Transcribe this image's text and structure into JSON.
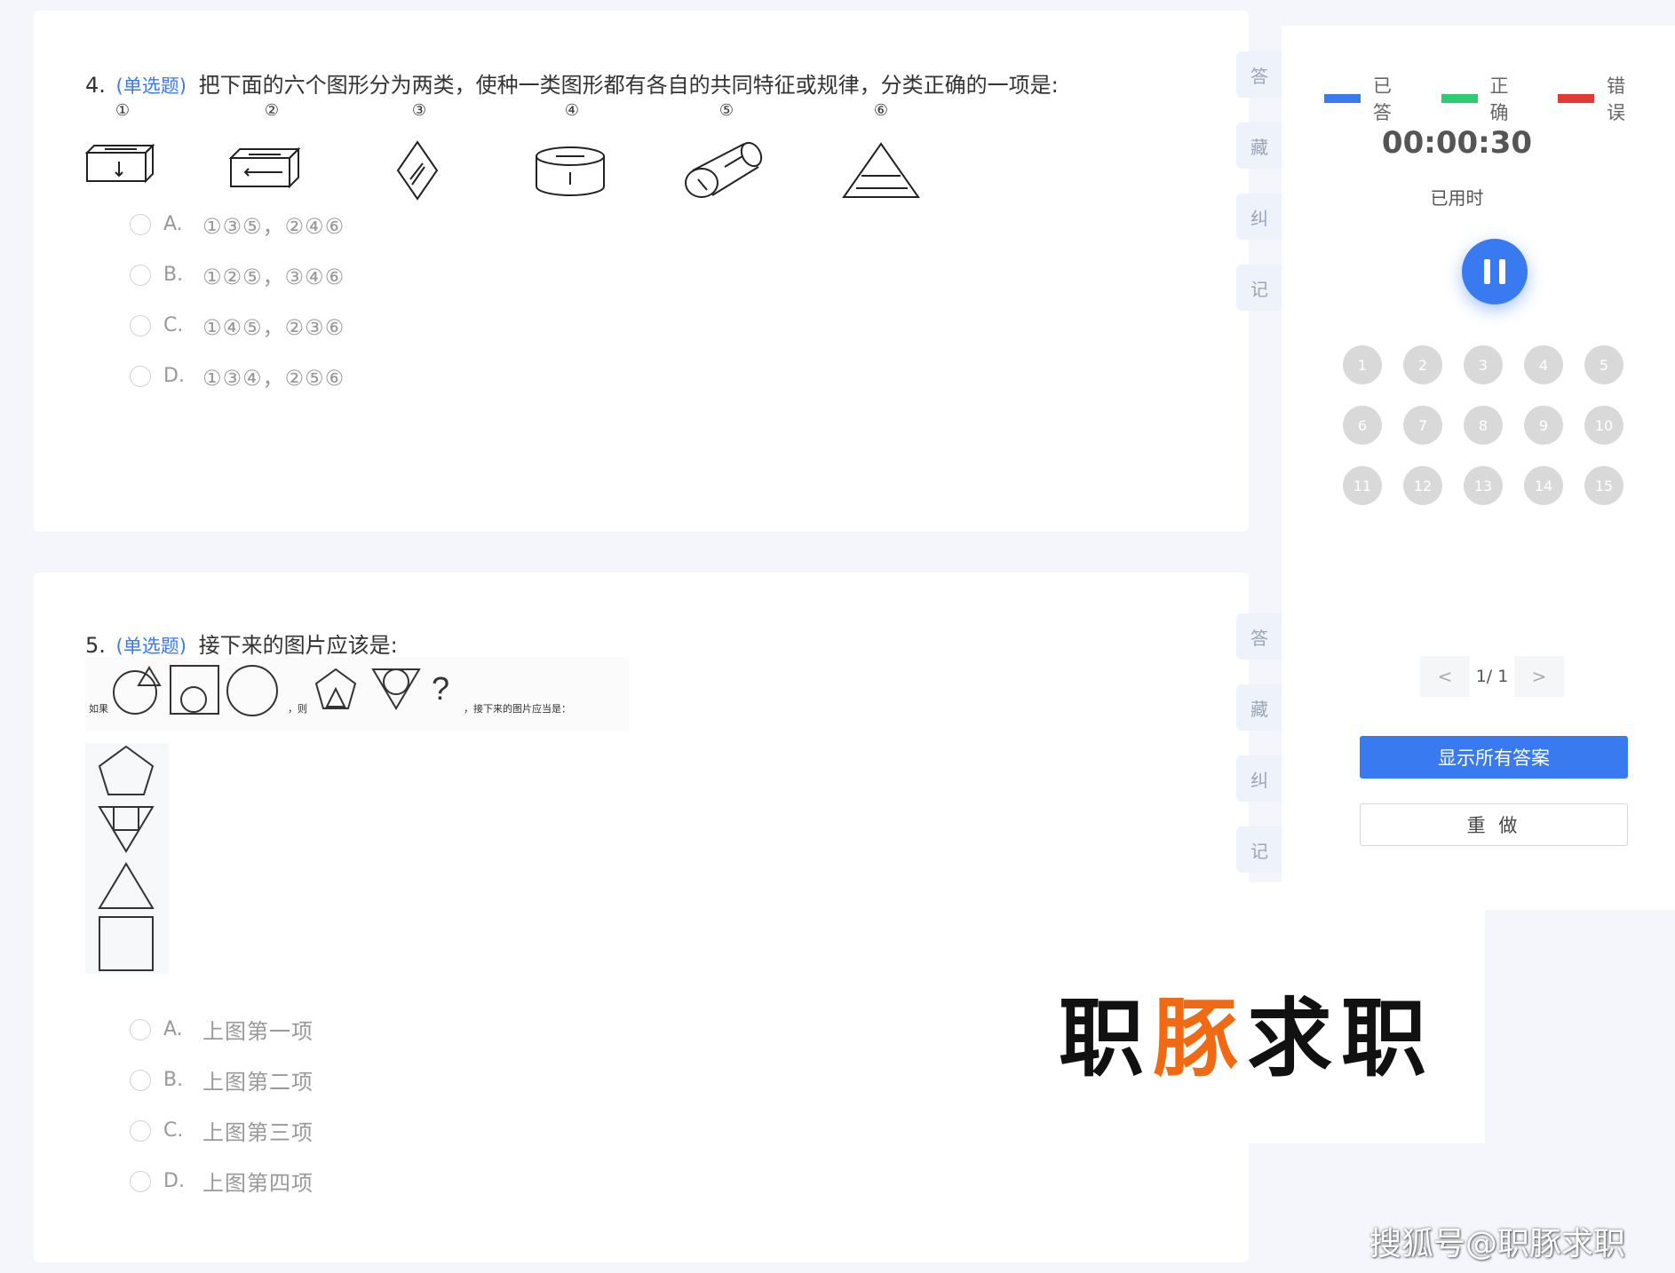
{
  "questions": [
    {
      "number": "4.",
      "type": "(单选题)",
      "stem": "把下面的六个图形分为两类，使种一类图形都有各自的共同特征或规律，分类正确的一项是:",
      "figure_labels": [
        "①",
        "②",
        "③",
        "④",
        "⑤",
        "⑥"
      ],
      "options": [
        {
          "letter": "A.",
          "text": "①③⑤，②④⑥"
        },
        {
          "letter": "B.",
          "text": "①②⑤，③④⑥"
        },
        {
          "letter": "C.",
          "text": "①④⑤，②③⑥"
        },
        {
          "letter": "D.",
          "text": "①③④，②⑤⑥"
        }
      ]
    },
    {
      "number": "5.",
      "type": "(单选题)",
      "stem": "接下来的图片应该是:",
      "figure_text": {
        "if": "如果",
        "then": "，则",
        "question_mark": "?",
        "prompt": "，接下来的图片应当是："
      },
      "options": [
        {
          "letter": "A.",
          "text": "上图第一项"
        },
        {
          "letter": "B.",
          "text": "上图第二项"
        },
        {
          "letter": "C.",
          "text": "上图第三项"
        },
        {
          "letter": "D.",
          "text": "上图第四项"
        }
      ]
    }
  ],
  "side_tools": [
    "答",
    "藏",
    "纠",
    "记"
  ],
  "panel": {
    "legend": [
      {
        "label": "已答",
        "color": "#3a7af0"
      },
      {
        "label": "正确",
        "color": "#2ecc71"
      },
      {
        "label": "错误",
        "color": "#e53935"
      }
    ],
    "timer": "00:00:30",
    "timer_label": "已用时",
    "question_numbers": [
      "1",
      "2",
      "3",
      "4",
      "5",
      "6",
      "7",
      "8",
      "9",
      "10",
      "11",
      "12",
      "13",
      "14",
      "15"
    ],
    "pager": {
      "prev": "<",
      "text": "1/ 1",
      "next": ">"
    },
    "show_answers_label": "显示所有答案",
    "redo_label": "重 做"
  },
  "watermark": {
    "brand_part1": "职",
    "brand_part2": "豚",
    "brand_part3": "求职",
    "source": "搜狐号@职豚求职"
  }
}
